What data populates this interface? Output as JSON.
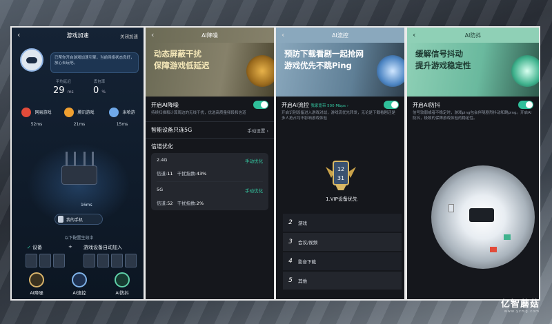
{
  "p1": {
    "title": "游戏加速",
    "close": "关闭加速",
    "bubble": "已帮你开启游戏加速引擎，当前网络状态良好，放心去玩吧。",
    "stats": [
      {
        "label": "平均延迟",
        "value": "29",
        "unit": "ms"
      },
      {
        "label": "丢包率",
        "value": "0",
        "unit": "%"
      }
    ],
    "servers": [
      {
        "name": "网易游戏",
        "ms": "52ms",
        "color": "#e24b3a"
      },
      {
        "name": "腾讯游戏",
        "ms": "21ms",
        "color": "#f0a030"
      },
      {
        "name": "米哈游",
        "ms": "15ms",
        "color": "#6fa8e8"
      }
    ],
    "latency": "16ms",
    "myphone": "我的手机",
    "section": "以下配置生效中",
    "dev_label": "设备",
    "plus": "+",
    "auto_add": "游戏设备自动加入",
    "nav": [
      "AI降噪",
      "AI流控",
      "AI防抖"
    ]
  },
  "p2": {
    "title": "AI降噪",
    "banner": [
      "动态屏蔽干扰",
      "保障游戏低延迟"
    ],
    "toggle_label": "开启AI降噪",
    "toggle_desc": "持续扫描和计算周边的无线干扰，优选高质量频段和信道",
    "smart": "智能设备只连5G",
    "smart_action": "手动设置",
    "channel_title": "信道优化",
    "bands": [
      {
        "band": "2.4G",
        "action": "手动优化",
        "ch_label": "信道:",
        "ch": "11",
        "idx_label": "干扰指数:",
        "idx": "43%"
      },
      {
        "band": "5G",
        "action": "手动优化",
        "ch_label": "信道:",
        "ch": "52",
        "idx_label": "干扰指数:",
        "idx": "2%"
      }
    ]
  },
  "p3": {
    "title": "AI流控",
    "banner": [
      "预防下载看剧一起抢网",
      "游戏优先不跳Ping"
    ],
    "toggle_label": "开启AI流控",
    "bw": "我家宽带 500 Mbps",
    "desc": "开启识别设备进入游戏对战，游戏流优先转发，无论是下载看剧还是多人抢占均不影响游戏体验",
    "badge_top": "12",
    "badge_bottom": "31",
    "vip": "1.VIP设备优先",
    "prios": [
      {
        "n": "2",
        "t": "游戏"
      },
      {
        "n": "3",
        "t": "会议/视频"
      },
      {
        "n": "4",
        "t": "影音下载"
      },
      {
        "n": "5",
        "t": "其他"
      }
    ]
  },
  "p4": {
    "title": "AI防抖",
    "banner": [
      "缓解信号抖动",
      "提升游戏稳定性"
    ],
    "toggle_label": "开启AI防抖",
    "desc": "信号较弱或者不稳定时，游戏ping包会伴随剧烈抖动和跳ping。开启AI防抖，极致的保障游戏体验的稳定性。"
  },
  "watermark": {
    "main": "亿智蘑菇",
    "sub": "www.yzmg.com"
  }
}
